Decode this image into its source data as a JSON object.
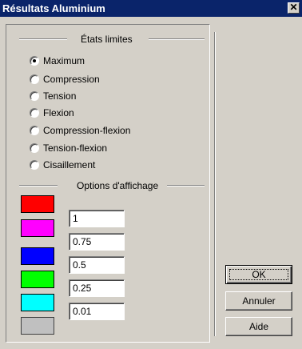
{
  "window": {
    "title": "Résultats Aluminium",
    "close_glyph": "✕"
  },
  "limit_states": {
    "heading": "États limites",
    "options": [
      {
        "label": "Maximum",
        "checked": true
      },
      {
        "label": "Compression",
        "checked": false
      },
      {
        "label": "Tension",
        "checked": false
      },
      {
        "label": "Flexion",
        "checked": false
      },
      {
        "label": "Compression-flexion",
        "checked": false
      },
      {
        "label": "Tension-flexion",
        "checked": false
      },
      {
        "label": "Cisaillement",
        "checked": false
      }
    ]
  },
  "display_options": {
    "heading": "Options d'affichage",
    "swatches": [
      {
        "color": "#ff0000",
        "value": "1"
      },
      {
        "color": "#ff00ff",
        "value": "0.75"
      },
      {
        "color": "#0000ff",
        "value": "0.5"
      },
      {
        "color": "#00ff00",
        "value": "0.25"
      },
      {
        "color": "#00ffff",
        "value": "0.01"
      },
      {
        "color": "#c0c0c0",
        "value": null
      }
    ]
  },
  "buttons": {
    "ok": "OK",
    "cancel": "Annuler",
    "help": "Aide"
  }
}
